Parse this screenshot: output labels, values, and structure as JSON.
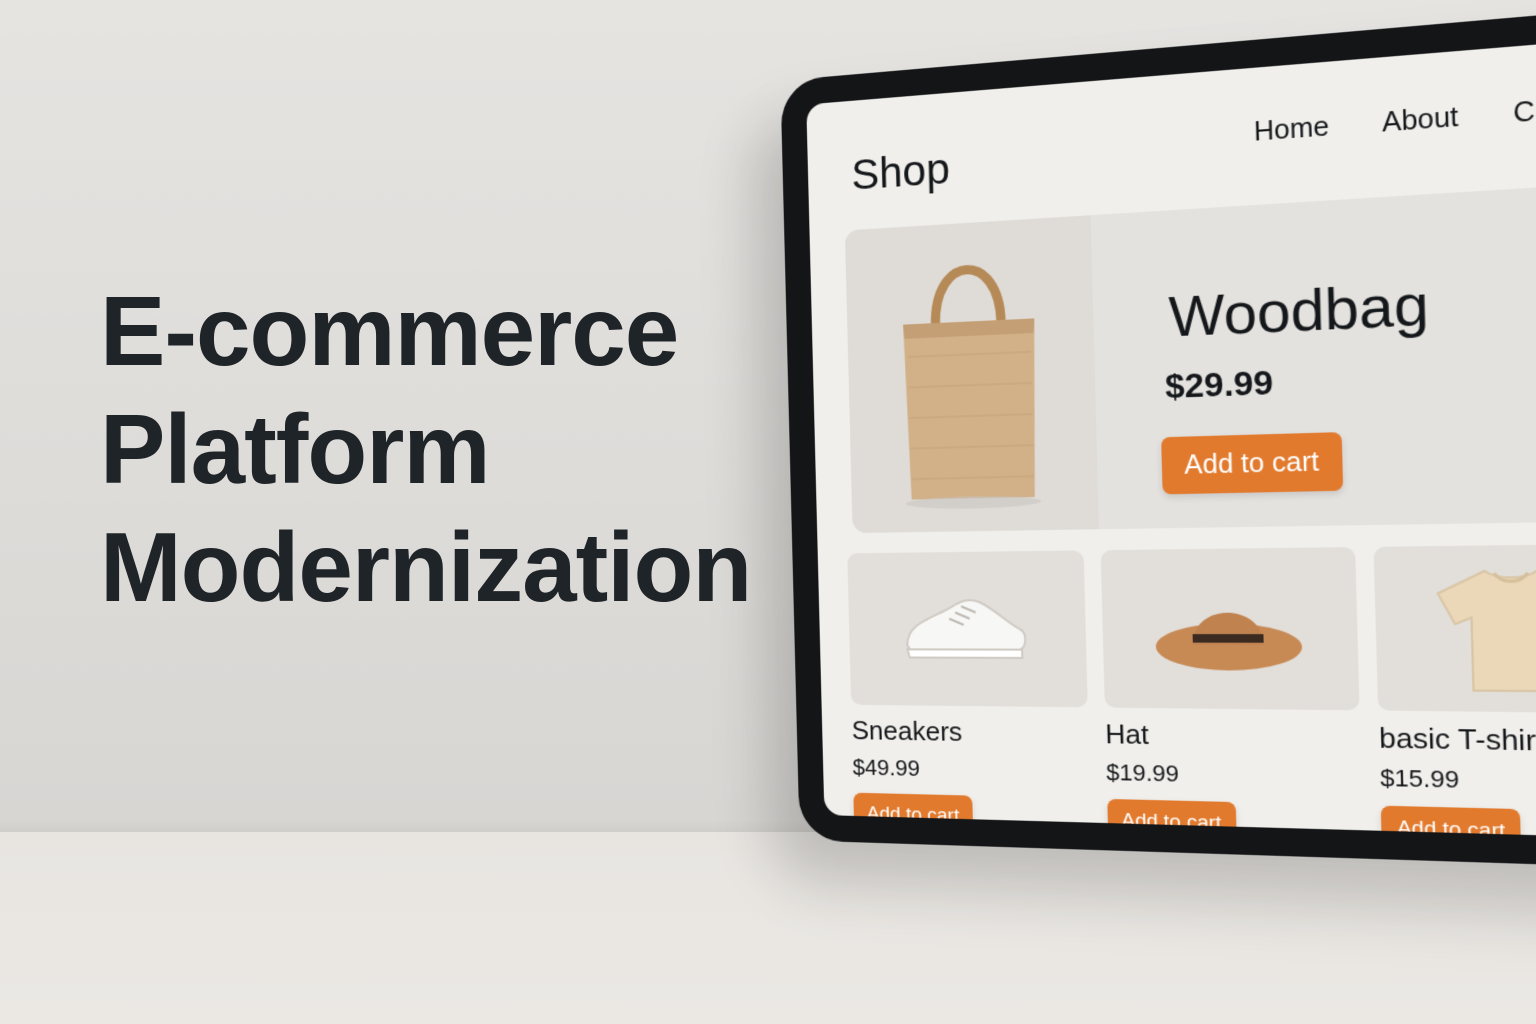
{
  "headline": [
    "E-commerce",
    "Platform",
    "Modernization"
  ],
  "shop": {
    "logo": "Shop",
    "nav": [
      "Home",
      "About",
      "Contact"
    ],
    "featured": {
      "name": "Woodbag",
      "price": "$29.99",
      "button": "Add to cart",
      "icon": "tote-bag-icon"
    },
    "products": [
      {
        "name": "Sneakers",
        "price": "$49.99",
        "button": "Add to cart",
        "icon": "sneaker-icon"
      },
      {
        "name": "Hat",
        "price": "$19.99",
        "button": "Add to cart",
        "icon": "hat-icon"
      },
      {
        "name": "basic T-shirt",
        "price": "$15.99",
        "button": "Add to cart",
        "icon": "tshirt-icon"
      }
    ]
  },
  "colors": {
    "accent": "#e27a2e",
    "text": "#1f2428",
    "background": "#e6e4e1",
    "bezel": "#131517"
  }
}
